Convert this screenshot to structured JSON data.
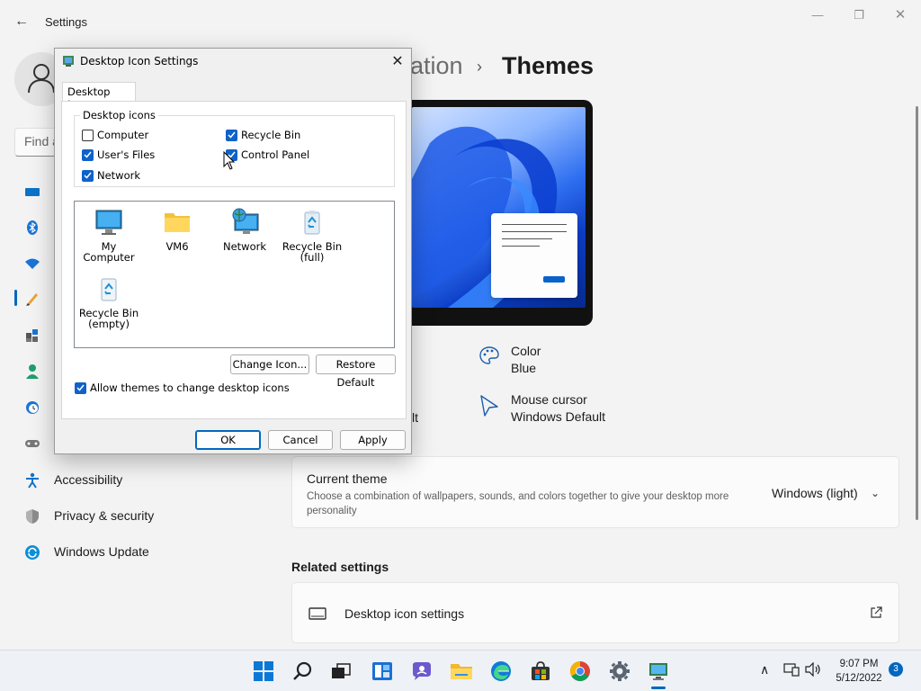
{
  "window": {
    "app_title": "Settings",
    "back_glyph": "←",
    "minimize_glyph": "—",
    "maximize_glyph": "❐",
    "close_glyph": "✕"
  },
  "sidebar": {
    "search_placeholder": "Find a",
    "items": [
      {
        "label": "",
        "icon": "system-icon"
      },
      {
        "label": "",
        "icon": "bluetooth-icon"
      },
      {
        "label": "",
        "icon": "network-wifi-icon"
      },
      {
        "label": "",
        "icon": "personalization-brush-icon",
        "selected": true
      },
      {
        "label": "",
        "icon": "apps-icon"
      },
      {
        "label": "",
        "icon": "accounts-icon"
      },
      {
        "label": "",
        "icon": "time-language-icon"
      },
      {
        "label": "",
        "icon": "gaming-icon"
      },
      {
        "label": "Accessibility",
        "icon": "accessibility-icon"
      },
      {
        "label": "Privacy & security",
        "icon": "shield-icon"
      },
      {
        "label": "Windows Update",
        "icon": "windows-update-icon"
      }
    ]
  },
  "header": {
    "parent": "ation",
    "separator": "›",
    "current": "Themes"
  },
  "theme_props": {
    "background_value_tail": "lt",
    "color": {
      "label": "Color",
      "value": "Blue",
      "icon": "palette-icon"
    },
    "cursor": {
      "label": "Mouse cursor",
      "value": "Windows Default",
      "icon": "mouse-cursor-icon"
    }
  },
  "current_theme": {
    "title": "Current theme",
    "description": "Choose a combination of wallpapers, sounds, and colors together to give your desktop more personality",
    "value": "Windows (light)",
    "chevron": "⌄"
  },
  "related": {
    "heading": "Related settings",
    "desktop_icon_settings": "Desktop icon settings"
  },
  "dialog": {
    "title": "Desktop Icon Settings",
    "close_glyph": "✕",
    "tab_label": "Desktop Icons",
    "group_label": "Desktop icons",
    "checkboxes": [
      {
        "label": "Computer",
        "checked": false
      },
      {
        "label": "Recycle Bin",
        "checked": true
      },
      {
        "label": "User's Files",
        "checked": true
      },
      {
        "label": "Control Panel",
        "checked": true
      },
      {
        "label": "Network",
        "checked": true
      }
    ],
    "icons": [
      {
        "label": "My Computer",
        "icon": "monitor-icon"
      },
      {
        "label": "VM6",
        "icon": "folder-icon"
      },
      {
        "label": "Network",
        "icon": "network-globe-icon"
      },
      {
        "label": "Recycle Bin (full)",
        "icon": "recycle-bin-full-icon"
      },
      {
        "label": "Recycle Bin (empty)",
        "icon": "recycle-bin-empty-icon"
      }
    ],
    "change_icon": "Change Icon...",
    "restore_default": "Restore Default",
    "allow_themes": {
      "label": "Allow themes to change desktop icons",
      "checked": true
    },
    "ok": "OK",
    "cancel": "Cancel",
    "apply": "Apply"
  },
  "taskbar": {
    "apps": [
      "start-icon",
      "search-icon",
      "task-view-icon",
      "widgets-icon",
      "chat-icon",
      "file-explorer-icon",
      "edge-icon",
      "store-icon",
      "chrome-icon",
      "settings-gear-icon",
      "desktop-icon-settings-app-icon"
    ],
    "time": "9:07 PM",
    "date": "5/12/2022",
    "notifications": "3",
    "chevron_glyph": "∧"
  },
  "colors": {
    "accent": "#0067c0",
    "checkbox_checked": "#0f62c9",
    "window_bg": "#f3f3f3",
    "dialog_bg": "#f0f0f0"
  }
}
